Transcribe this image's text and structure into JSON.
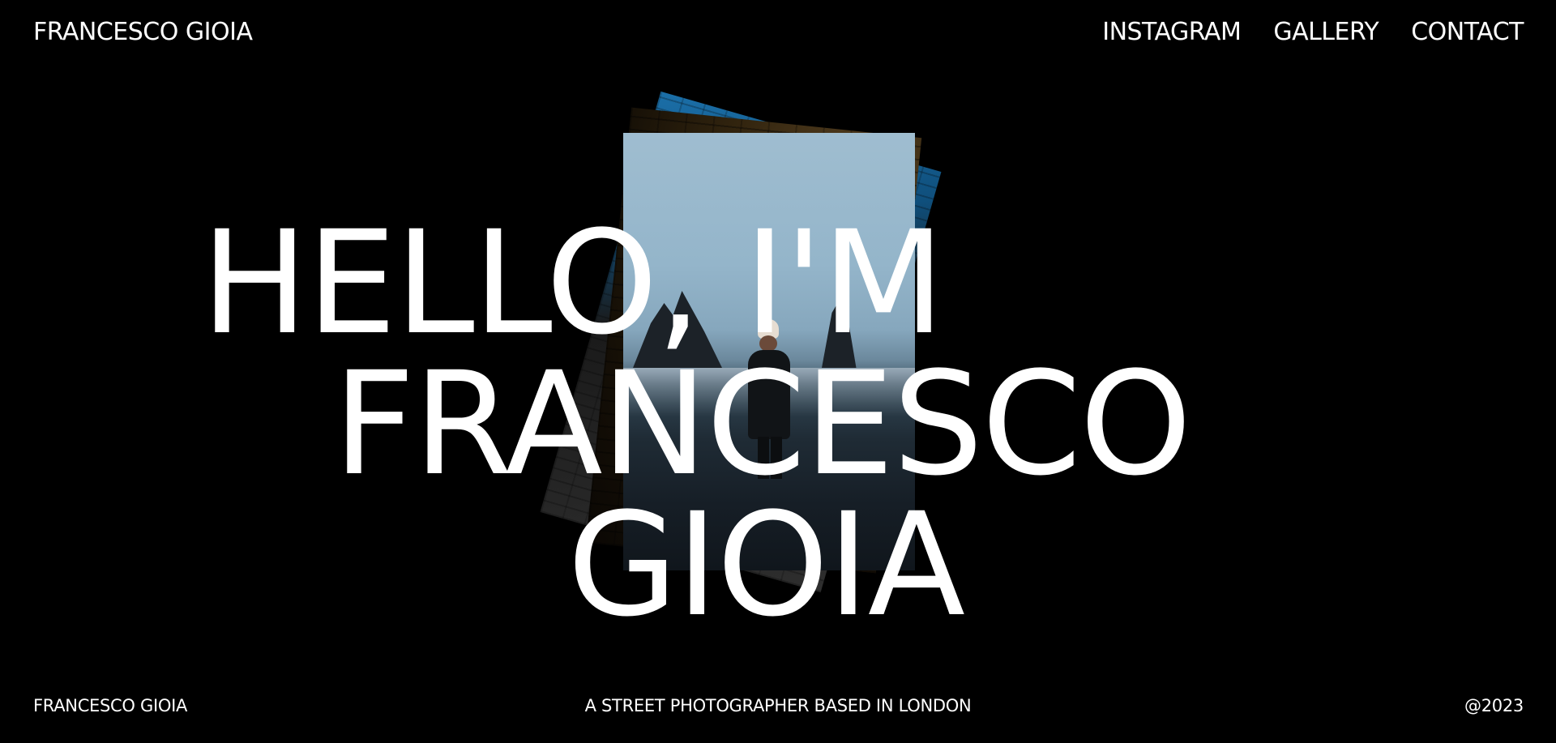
{
  "header": {
    "brand": "FRANCESCO GIOIA",
    "nav": [
      {
        "label": "INSTAGRAM"
      },
      {
        "label": "GALLERY"
      },
      {
        "label": "CONTACT"
      }
    ]
  },
  "hero": {
    "line1": "HELLO, I'M",
    "line2": "FRANCESCO",
    "line3": "GIOIA"
  },
  "footer": {
    "name": "FRANCESCO GIOIA",
    "tagline": "A STREET PHOTOGRAPHER BASED IN LONDON",
    "year": "@2023"
  },
  "colors": {
    "background": "#000000",
    "text": "#ffffff"
  }
}
